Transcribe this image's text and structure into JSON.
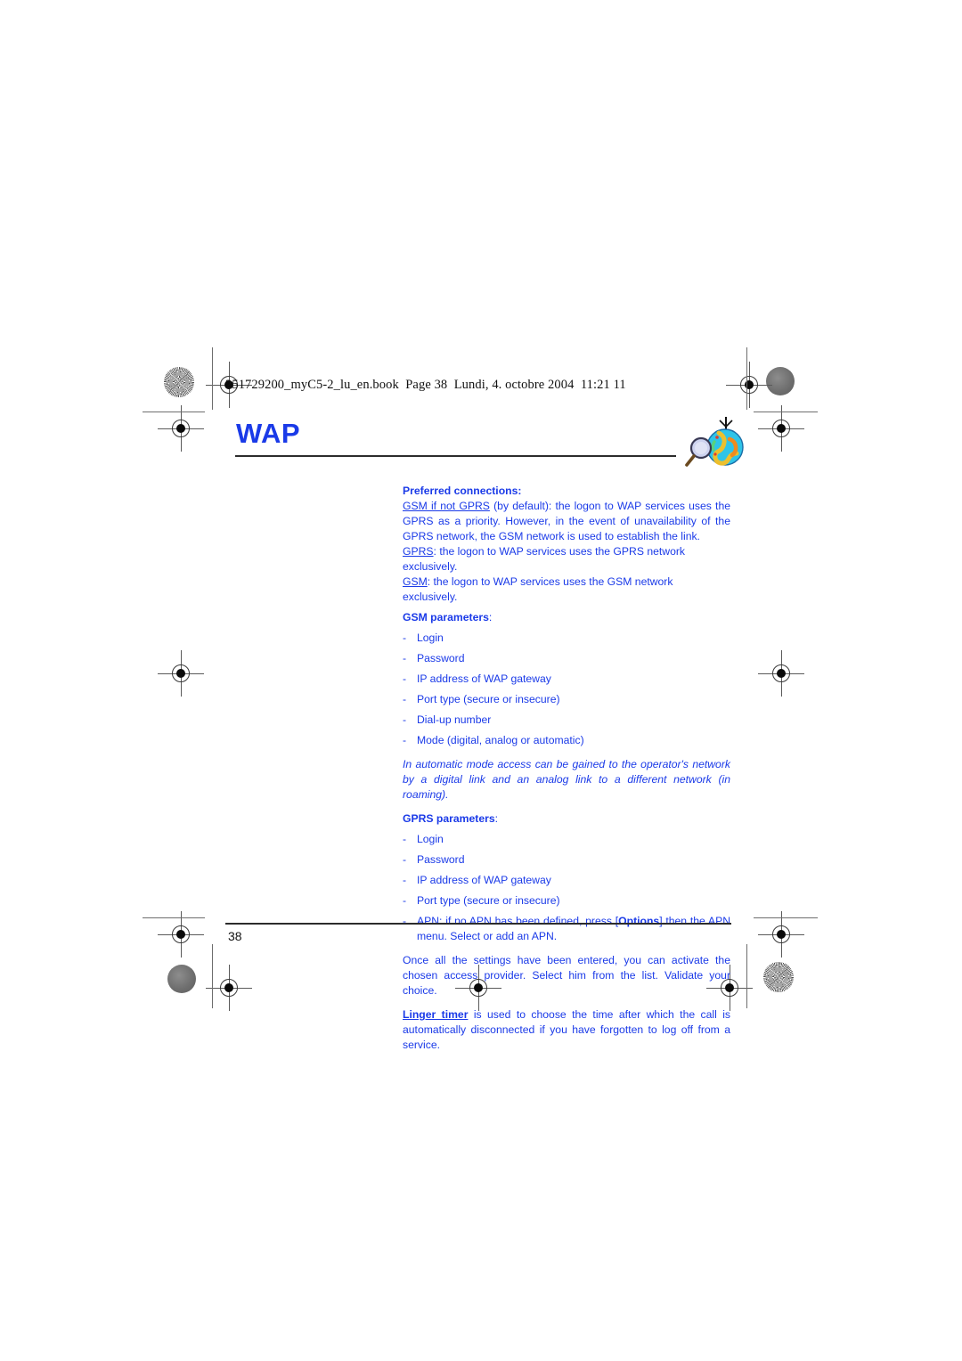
{
  "book_header": "251729200_myC5-2_lu_en.book  Page 38  Lundi, 4. octobre 2004  11:21 11",
  "chapter": {
    "title": "WAP",
    "icon": "globe-magnifier-icon",
    "title_color": "#1a3ae8"
  },
  "body": {
    "preferred_heading": "Preferred connections:",
    "pref_line1_link": "GSM if not GPRS",
    "pref_line1_rest": " (by default): the logon to WAP services uses the GPRS as a priority. However, in the event of unavailability of the GPRS network, the GSM network is used to establish the link.",
    "pref_line2_link": "GPRS",
    "pref_line2_rest": ": the logon to WAP services uses the GPRS network exclusively.",
    "pref_line3_link": "GSM",
    "pref_line3_rest": ": the logon to WAP services uses the GSM network exclusively.",
    "gsm_heading": "GSM parameters",
    "gsm_heading_colon": ":",
    "gsm_items": [
      "Login",
      "Password",
      "IP address of WAP gateway",
      "Port type (secure or insecure)",
      "Dial-up number",
      "Mode (digital, analog or automatic)"
    ],
    "automatic_note": "In automatic mode access can be gained to the operator's network by a digital link and an analog link to a different network (in roaming).",
    "gprs_heading": "GPRS parameters",
    "gprs_heading_colon": ":",
    "gprs_items": [
      "Login",
      "Password",
      "IP address of WAP gateway",
      "Port type (secure or insecure)"
    ],
    "apn_item_pre": "APN: if no APN has been defined, press [",
    "apn_item_bold": "Options",
    "apn_item_post": "] then the APN menu. Select or add an APN.",
    "settings_para": "Once all the settings have been entered, you can activate the chosen access provider. Select him from the list. Validate your choice.",
    "linger_label": "Linger timer",
    "linger_rest": " is used to choose the time after which the call is automatically disconnected if you have forgotten to log off from a service.",
    "dash": "-"
  },
  "footer": {
    "page_number": "38"
  }
}
